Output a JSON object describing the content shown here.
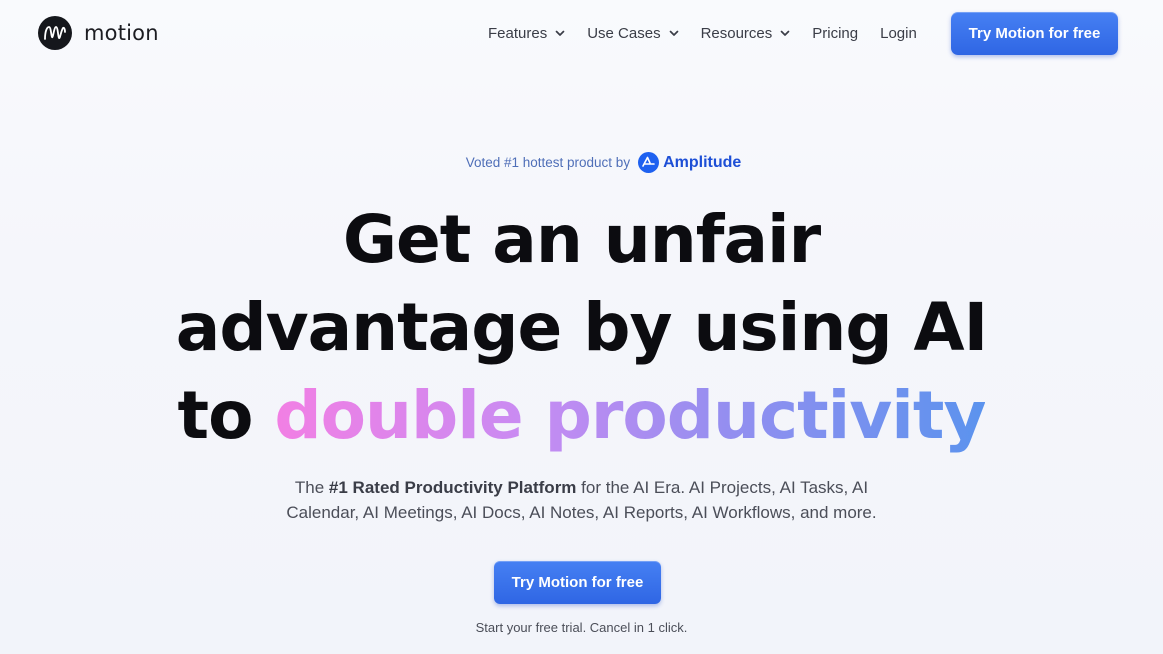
{
  "header": {
    "logo_text": "motion",
    "nav": [
      {
        "label": "Features",
        "has_dropdown": true,
        "icon": "chevron-down-icon"
      },
      {
        "label": "Use Cases",
        "has_dropdown": true,
        "icon": "chevron-down-icon"
      },
      {
        "label": "Resources",
        "has_dropdown": true,
        "icon": "chevron-down-icon"
      },
      {
        "label": "Pricing",
        "has_dropdown": false
      },
      {
        "label": "Login",
        "has_dropdown": false
      }
    ],
    "cta_label": "Try Motion for free"
  },
  "hero": {
    "badge_text": "Voted #1 hottest product by",
    "badge_brand": "Amplitude",
    "badge_icon": "amplitude-logo-icon",
    "headline_line1": "Get an unfair",
    "headline_line2": "advantage by using AI",
    "headline_line3_plain": "to",
    "headline_line3_gradient": "double productivity",
    "subtext_pre": "The",
    "subtext_bold": "#1 Rated Productivity Platform",
    "subtext_post_line1": "for the AI Era. AI Projects, AI Tasks, AI",
    "subtext_line2": "Calendar, AI Meetings, AI Docs, AI Notes, AI Reports, AI Workflows, and more.",
    "cta_label": "Try Motion for free",
    "trial_note": "Start your free trial. Cancel in 1 click."
  },
  "colors": {
    "accent": "#2f66e4",
    "gradient_start": "#f27fe4",
    "gradient_end": "#5b93ee",
    "text_dark": "#0c0c10"
  }
}
